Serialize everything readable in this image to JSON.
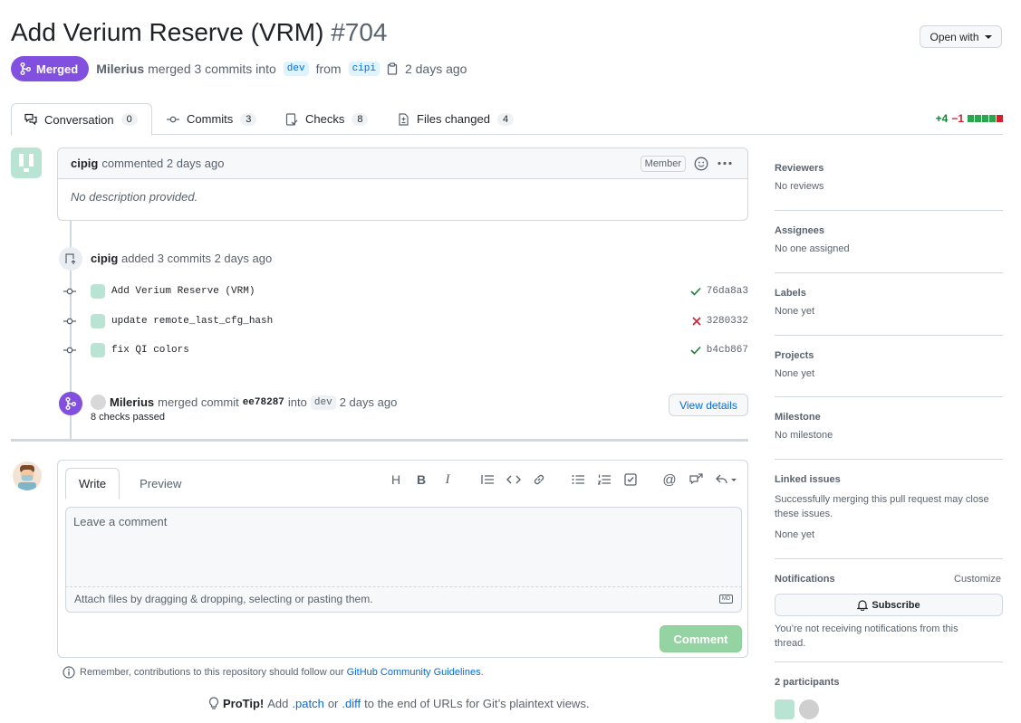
{
  "pr": {
    "title": "Add Verium Reserve (VRM)",
    "number": "#704",
    "state": "Merged",
    "author": "Milerius",
    "merge_text": "merged 3 commits into",
    "base_branch": "dev",
    "from_word": "from",
    "head_branch": "cipi",
    "time": "2 days ago"
  },
  "header": {
    "open_with": "Open with"
  },
  "tabs": [
    {
      "label": "Conversation",
      "count": "0"
    },
    {
      "label": "Commits",
      "count": "3"
    },
    {
      "label": "Checks",
      "count": "8"
    },
    {
      "label": "Files changed",
      "count": "4"
    }
  ],
  "diffstat": {
    "additions": "+4",
    "deletions": "−1"
  },
  "comment": {
    "author": "cipig",
    "action": "commented 2 days ago",
    "role": "Member",
    "body": "No description provided."
  },
  "commits_event": {
    "author": "cipig",
    "text": "added 3 commits 2 days ago"
  },
  "commits": [
    {
      "message": "Add Verium Reserve (VRM)",
      "status": "success",
      "sha": "76da8a3"
    },
    {
      "message": "update remote_last_cfg_hash",
      "status": "failure",
      "sha": "3280332"
    },
    {
      "message": "fix QI colors",
      "status": "success",
      "sha": "b4cb867"
    }
  ],
  "merge_event": {
    "author": "Milerius",
    "action": "merged commit",
    "sha": "ee78287",
    "into": "into",
    "branch": "dev",
    "time": "2 days ago",
    "checks": "8 checks passed",
    "view_details": "View details"
  },
  "composer": {
    "write_tab": "Write",
    "preview_tab": "Preview",
    "placeholder": "Leave a comment",
    "attach_text": "Attach files by dragging & dropping, selecting or pasting them.",
    "submit": "Comment",
    "md_badge": "MD"
  },
  "footer": {
    "remember_prefix": "Remember, contributions to this repository should follow our",
    "remember_link": "GitHub Community Guidelines",
    "remember_suffix": ".",
    "protip_label": "ProTip!",
    "protip_add": "Add",
    "protip_patch": ".patch",
    "protip_or": "or",
    "protip_diff": ".diff",
    "protip_rest": "to the end of URLs for Git’s plaintext views."
  },
  "sidebar": {
    "reviewers": {
      "title": "Reviewers",
      "value": "No reviews"
    },
    "assignees": {
      "title": "Assignees",
      "value": "No one assigned"
    },
    "labels": {
      "title": "Labels",
      "value": "None yet"
    },
    "projects": {
      "title": "Projects",
      "value": "None yet"
    },
    "milestone": {
      "title": "Milestone",
      "value": "No milestone"
    },
    "linked_issues": {
      "title": "Linked issues",
      "description": "Successfully merging this pull request may close these issues.",
      "value": "None yet"
    },
    "notifications": {
      "title": "Notifications",
      "customize": "Customize",
      "subscribe": "Subscribe",
      "note": "You’re not receiving notifications from this thread."
    },
    "participants": {
      "title": "2 participants"
    }
  },
  "colors": {
    "merged_purple": "#8250df",
    "success_green": "#1a7f37",
    "failure_red": "#cf222e",
    "link_blue": "#0969da",
    "comment_button_disabled": "#94d3a2"
  }
}
